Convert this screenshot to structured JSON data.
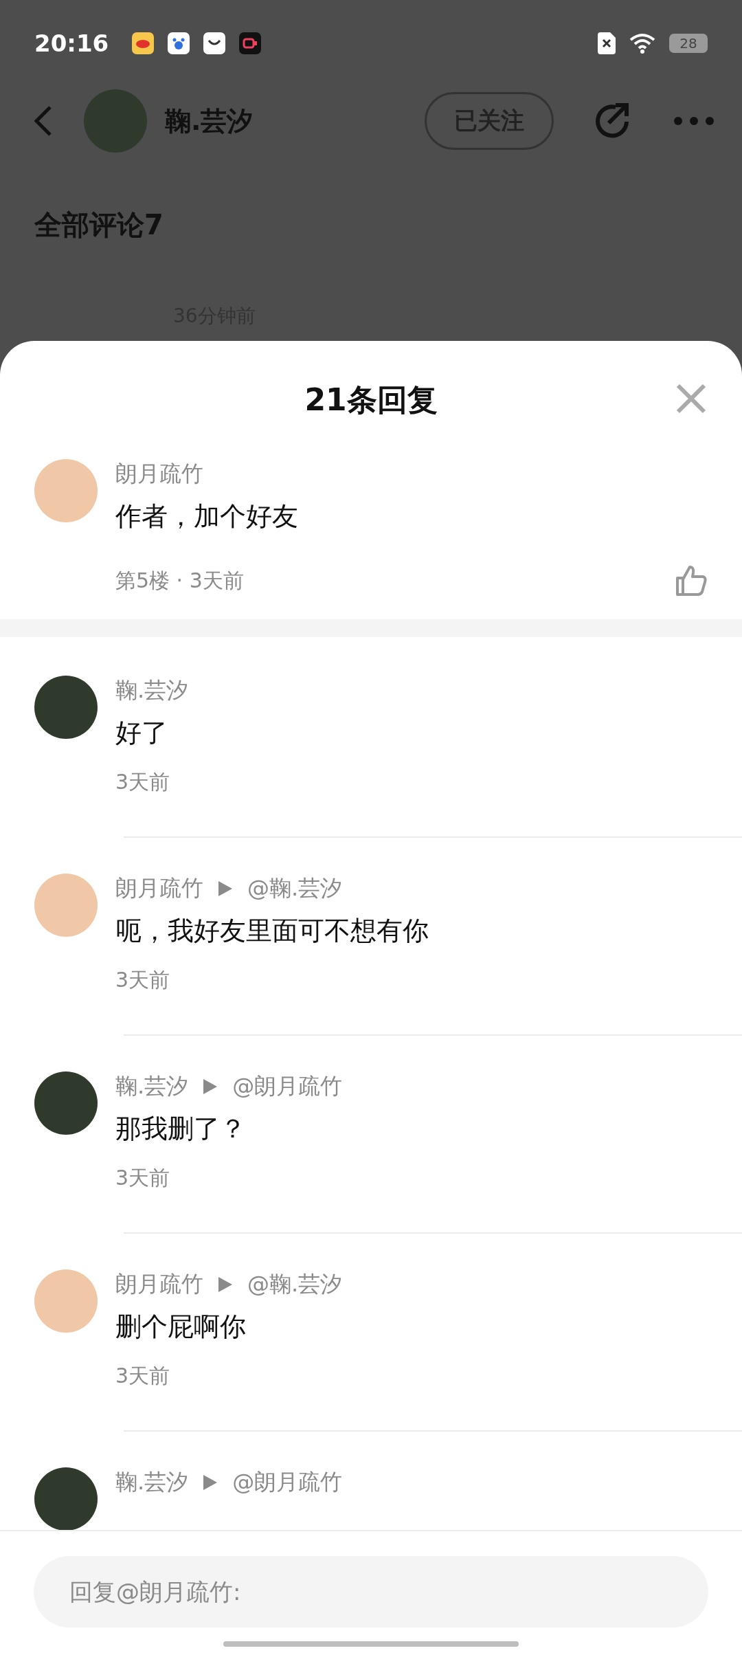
{
  "status_bar": {
    "time": "20:16",
    "battery": "28"
  },
  "header": {
    "author": "鞠.芸汐",
    "follow_button": "已关注"
  },
  "comments_heading": "全部评论7",
  "background_comment": {
    "time": "36分钟前"
  },
  "sheet": {
    "title": "21条回复",
    "main_comment": {
      "name": "朗月疏竹",
      "text": "作者，加个好友",
      "meta": "第5楼 · 3天前",
      "liked": false
    },
    "replies": [
      {
        "name": "鞠.芸汐",
        "text": "好了",
        "time": "3天前"
      },
      {
        "name": "朗月疏竹",
        "target": "@鞠.芸汐",
        "text": "呃，我好友里面可不想有你",
        "time": "3天前"
      },
      {
        "name": "鞠.芸汐",
        "target": "@朗月疏竹",
        "text": "那我删了？",
        "time": "3天前"
      },
      {
        "name": "朗月疏竹",
        "target": "@鞠.芸汐",
        "text": "删个屁啊你",
        "time": "3天前"
      },
      {
        "name": "鞠.芸汐",
        "target": "@朗月疏竹"
      }
    ],
    "input": {
      "placeholder": "回复@朗月疏竹:"
    }
  }
}
